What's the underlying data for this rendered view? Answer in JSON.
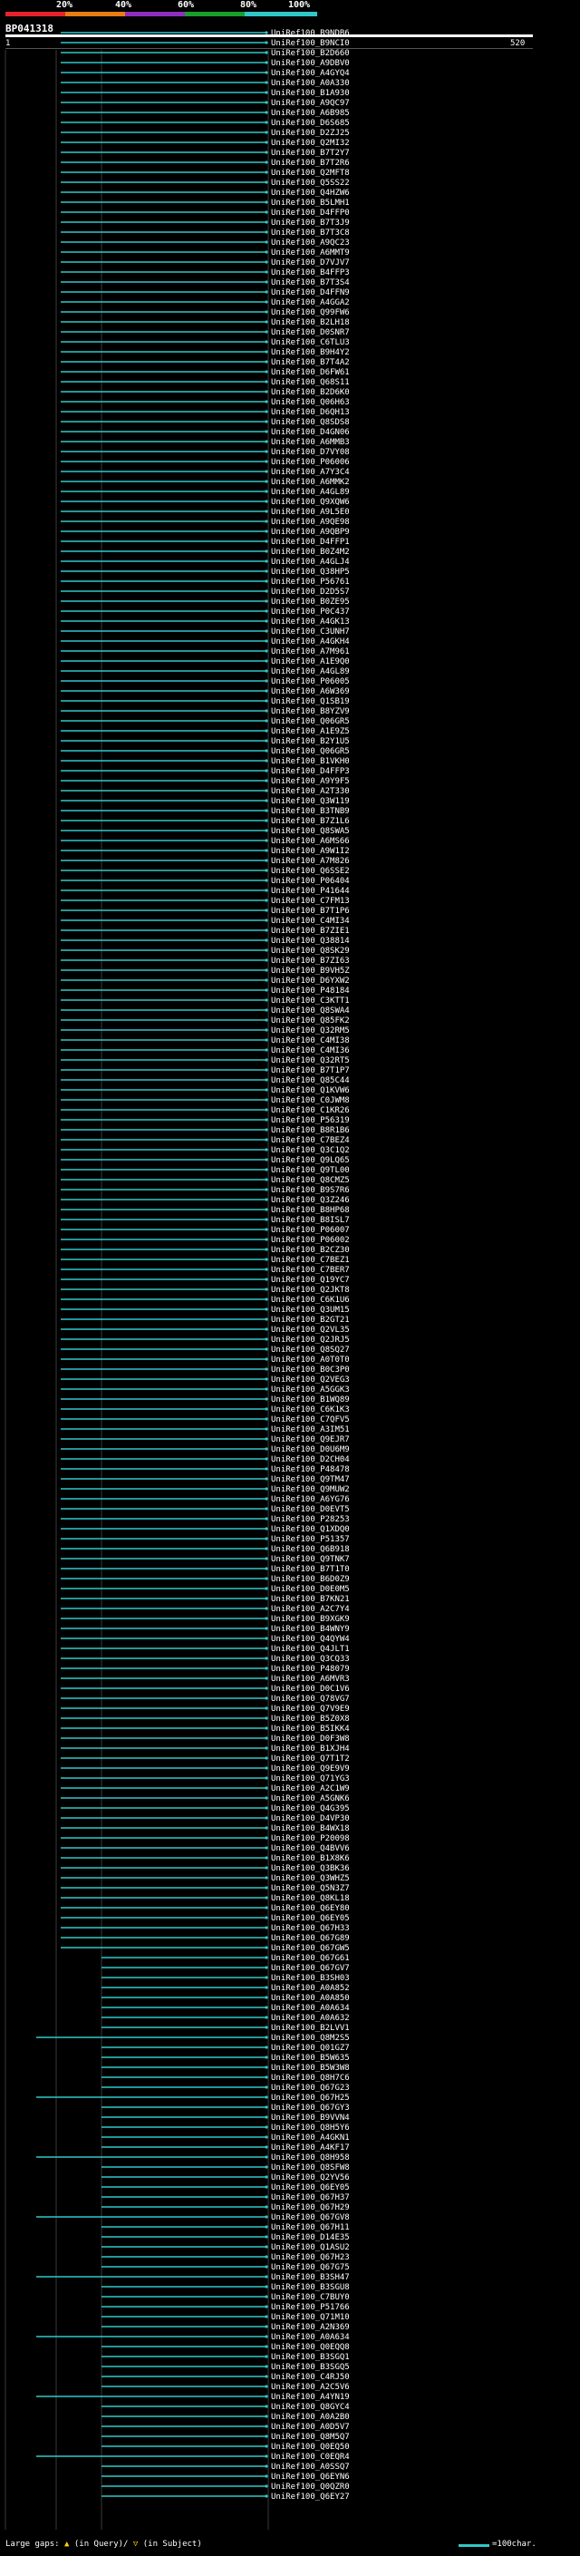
{
  "scale": {
    "labels": [
      "20%",
      "40%",
      "60%",
      "80%",
      "100%"
    ],
    "colors": [
      "#e8222c",
      "#e87d12",
      "#8f2fbf",
      "#1a9e2c",
      "#30c8c8"
    ]
  },
  "query": {
    "name": "BP041318",
    "start": "1",
    "end": "520"
  },
  "hits": [
    "UniRef100_B9NDB6",
    "UniRef100_B9NCI0",
    "UniRef100_B2D660",
    "UniRef100_A9DBV0",
    "UniRef100_A4GYQ4",
    "UniRef100_A0A330",
    "UniRef100_B1A930",
    "UniRef100_A9QC97",
    "UniRef100_A6B985",
    "UniRef100_D6S685",
    "UniRef100_D2ZJ25",
    "UniRef100_Q2MI32",
    "UniRef100_B7T2Y7",
    "UniRef100_B7T2R6",
    "UniRef100_Q2MFT8",
    "UniRef100_Q5SS22",
    "UniRef100_Q4HZW6",
    "UniRef100_B5LMH1",
    "UniRef100_D4FFP0",
    "UniRef100_B7T3J9",
    "UniRef100_B7T3C8",
    "UniRef100_A9QC23",
    "UniRef100_A6MMT9",
    "UniRef100_D7VJV7",
    "UniRef100_B4FFP3",
    "UniRef100_B7T3S4",
    "UniRef100_D4FFN9",
    "UniRef100_A4GGA2",
    "UniRef100_Q99FW6",
    "UniRef100_B2LH18",
    "UniRef100_D0SNR7",
    "UniRef100_C6TLU3",
    "UniRef100_B9H4Y2",
    "UniRef100_B7T4A2",
    "UniRef100_D6FW61",
    "UniRef100_Q68S11",
    "UniRef100_B2D6K0",
    "UniRef100_Q06H63",
    "UniRef100_D6QH13",
    "UniRef100_Q8SDS8",
    "UniRef100_D4GN06",
    "UniRef100_A6MMB3",
    "UniRef100_D7VY08",
    "UniRef100_P06006",
    "UniRef100_A7Y3C4",
    "UniRef100_A6MMK2",
    "UniRef100_A4GL89",
    "UniRef100_Q9XQW6",
    "UniRef100_A9L5E0",
    "UniRef100_A9QE98",
    "UniRef100_A9QBP9",
    "UniRef100_D4FFP1",
    "UniRef100_B0Z4M2",
    "UniRef100_A4GLJ4",
    "UniRef100_Q38HP5",
    "UniRef100_P56761",
    "UniRef100_D2D5S7",
    "UniRef100_B0ZE95",
    "UniRef100_P0C437",
    "UniRef100_A4GK13",
    "UniRef100_C3UNH7",
    "UniRef100_A4GKH4",
    "UniRef100_A7M961",
    "UniRef100_A1E9Q0",
    "UniRef100_A4GL89",
    "UniRef100_P06005",
    "UniRef100_A6W369",
    "UniRef100_Q1SB19",
    "UniRef100_B8YZV9",
    "UniRef100_Q06GR5",
    "UniRef100_A1E9Z5",
    "UniRef100_B2Y1U5",
    "UniRef100_Q06GR5",
    "UniRef100_B1VKH0",
    "UniRef100_D4FFP3",
    "UniRef100_A9Y9F5",
    "UniRef100_A2T330",
    "UniRef100_Q3W119",
    "UniRef100_B3TNB9",
    "UniRef100_B7Z1L6",
    "UniRef100_Q8SWA5",
    "UniRef100_A6MS66",
    "UniRef100_A9W1I2",
    "UniRef100_A7M826",
    "UniRef100_Q6SSE2",
    "UniRef100_P06404",
    "UniRef100_P41644",
    "UniRef100_C7FM13",
    "UniRef100_B7T1P6",
    "UniRef100_C4MI34",
    "UniRef100_B7ZIE1",
    "UniRef100_Q38814",
    "UniRef100_Q8SK29",
    "UniRef100_B7ZI63",
    "UniRef100_B9VH5Z",
    "UniRef100_D6YXW2",
    "UniRef100_P48184",
    "UniRef100_C3KTT1",
    "UniRef100_Q8SWA4",
    "UniRef100_Q85FK2",
    "UniRef100_Q32RM5",
    "UniRef100_C4MI38",
    "UniRef100_C4MI36",
    "UniRef100_Q32RT5",
    "UniRef100_B7T1P7",
    "UniRef100_Q85C44",
    "UniRef100_Q1KVW6",
    "UniRef100_C0JWM8",
    "UniRef100_C1KR26",
    "UniRef100_P56319",
    "UniRef100_B8R1B6",
    "UniRef100_C7BEZ4",
    "UniRef100_Q3C1Q2",
    "UniRef100_Q9LQ65",
    "UniRef100_Q9TL00",
    "UniRef100_Q8CMZ5",
    "UniRef100_B9S7R6",
    "UniRef100_Q3Z246",
    "UniRef100_B8HP68",
    "UniRef100_B8ISL7",
    "UniRef100_P06007",
    "UniRef100_P06002",
    "UniRef100_B2CZ30",
    "UniRef100_C7BEZ1",
    "UniRef100_C7BER7",
    "UniRef100_Q19YC7",
    "UniRef100_Q2JKT8",
    "UniRef100_C6K1U6",
    "UniRef100_Q3UM15",
    "UniRef100_B2GT21",
    "UniRef100_Q2VL35",
    "UniRef100_Q2JRJ5",
    "UniRef100_Q8SQ27",
    "UniRef100_A0T0T0",
    "UniRef100_B0C3P0",
    "UniRef100_Q2VEG3",
    "UniRef100_A5GGK3",
    "UniRef100_B1WQ89",
    "UniRef100_C6K1K3",
    "UniRef100_C7QFV5",
    "UniRef100_A3IM51",
    "UniRef100_Q9EJR7",
    "UniRef100_D0U6M9",
    "UniRef100_D2CH04",
    "UniRef100_P48478",
    "UniRef100_Q9TM47",
    "UniRef100_Q9MUW2",
    "UniRef100_A6YG76",
    "UniRef100_D0EVT5",
    "UniRef100_P28253",
    "UniRef100_Q1XDQ0",
    "UniRef100_P51357",
    "UniRef100_Q6B918",
    "UniRef100_Q9TNK7",
    "UniRef100_B7T1T0",
    "UniRef100_B6D0Z9",
    "UniRef100_D0E0M5",
    "UniRef100_B7KN21",
    "UniRef100_A2C7Y4",
    "UniRef100_B9XGK9",
    "UniRef100_B4WNY9",
    "UniRef100_Q4QYW4",
    "UniRef100_Q4JLT1",
    "UniRef100_Q3CQ33",
    "UniRef100_P48079",
    "UniRef100_A6MVR3",
    "UniRef100_D0C1V6",
    "UniRef100_Q78VG7",
    "UniRef100_Q7V9E9",
    "UniRef100_B5Z0X8",
    "UniRef100_B5IKK4",
    "UniRef100_D0F3W8",
    "UniRef100_B1XJH4",
    "UniRef100_Q7T1T2",
    "UniRef100_Q9E9V9",
    "UniRef100_Q71YG3",
    "UniRef100_A2C1W9",
    "UniRef100_A5GNK6",
    "UniRef100_Q4G395",
    "UniRef100_D4VP30",
    "UniRef100_B4WX18",
    "UniRef100_P20098",
    "UniRef100_Q4BVV6",
    "UniRef100_B1X8K6",
    "UniRef100_Q3BK36",
    "UniRef100_Q3WHZ5",
    "UniRef100_Q5N3Z7",
    "UniRef100_Q8KL18",
    "UniRef100_Q6EY80",
    "UniRef100_Q6EY05",
    "UniRef100_Q67H33",
    "UniRef100_Q67G89",
    "UniRef100_Q67GW5",
    "UniRef100_Q67G61",
    "UniRef100_Q67GV7",
    "UniRef100_B3SH03",
    "UniRef100_A0A852",
    "UniRef100_A0A850",
    "UniRef100_A0A634",
    "UniRef100_A0A632",
    "UniRef100_B2LVV1",
    "UniRef100_Q8M2S5",
    "UniRef100_Q01GZ7",
    "UniRef100_B5W635",
    "UniRef100_B5W3W8",
    "UniRef100_Q8H7C6",
    "UniRef100_Q67G23",
    "UniRef100_Q67H25",
    "UniRef100_Q67GY3",
    "UniRef100_B9VVN4",
    "UniRef100_Q8H5Y6",
    "UniRef100_A4GKN1",
    "UniRef100_A4KF17",
    "UniRef100_Q8H958",
    "UniRef100_Q8SFW8",
    "UniRef100_Q2YV56",
    "UniRef100_Q6EY05",
    "UniRef100_Q67H37",
    "UniRef100_Q67H29",
    "UniRef100_Q67GV8",
    "UniRef100_Q67H11",
    "UniRef100_D14E35",
    "UniRef100_Q1ASU2",
    "UniRef100_Q67H23",
    "UniRef100_Q67G75",
    "UniRef100_B3SH47",
    "UniRef100_B3SGU8",
    "UniRef100_C7BUY0",
    "UniRef100_P51766",
    "UniRef100_Q71M10",
    "UniRef100_A2N369",
    "UniRef100_A0A634",
    "UniRef100_Q0EQQ8",
    "UniRef100_B3SGQ1",
    "UniRef100_B3SGQ5",
    "UniRef100_C4RJ50",
    "UniRef100_A2C5V6",
    "UniRef100_A4YN19",
    "UniRef100_Q8GYC4",
    "UniRef100_A0A2B0",
    "UniRef100_A0D5V7",
    "UniRef100_Q8M5Q7",
    "UniRef100_Q0EQ50",
    "UniRef100_C0EQR4",
    "UniRef100_A0SSQ7",
    "UniRef100_Q6EYN6",
    "UniRef100_Q0QZR0",
    "UniRef100_Q6EY27"
  ],
  "legend": {
    "gaps_label": "Large gaps:",
    "in_query": "(in Query)/",
    "in_subject": "(in Subject)",
    "scale_label": "=100char."
  }
}
